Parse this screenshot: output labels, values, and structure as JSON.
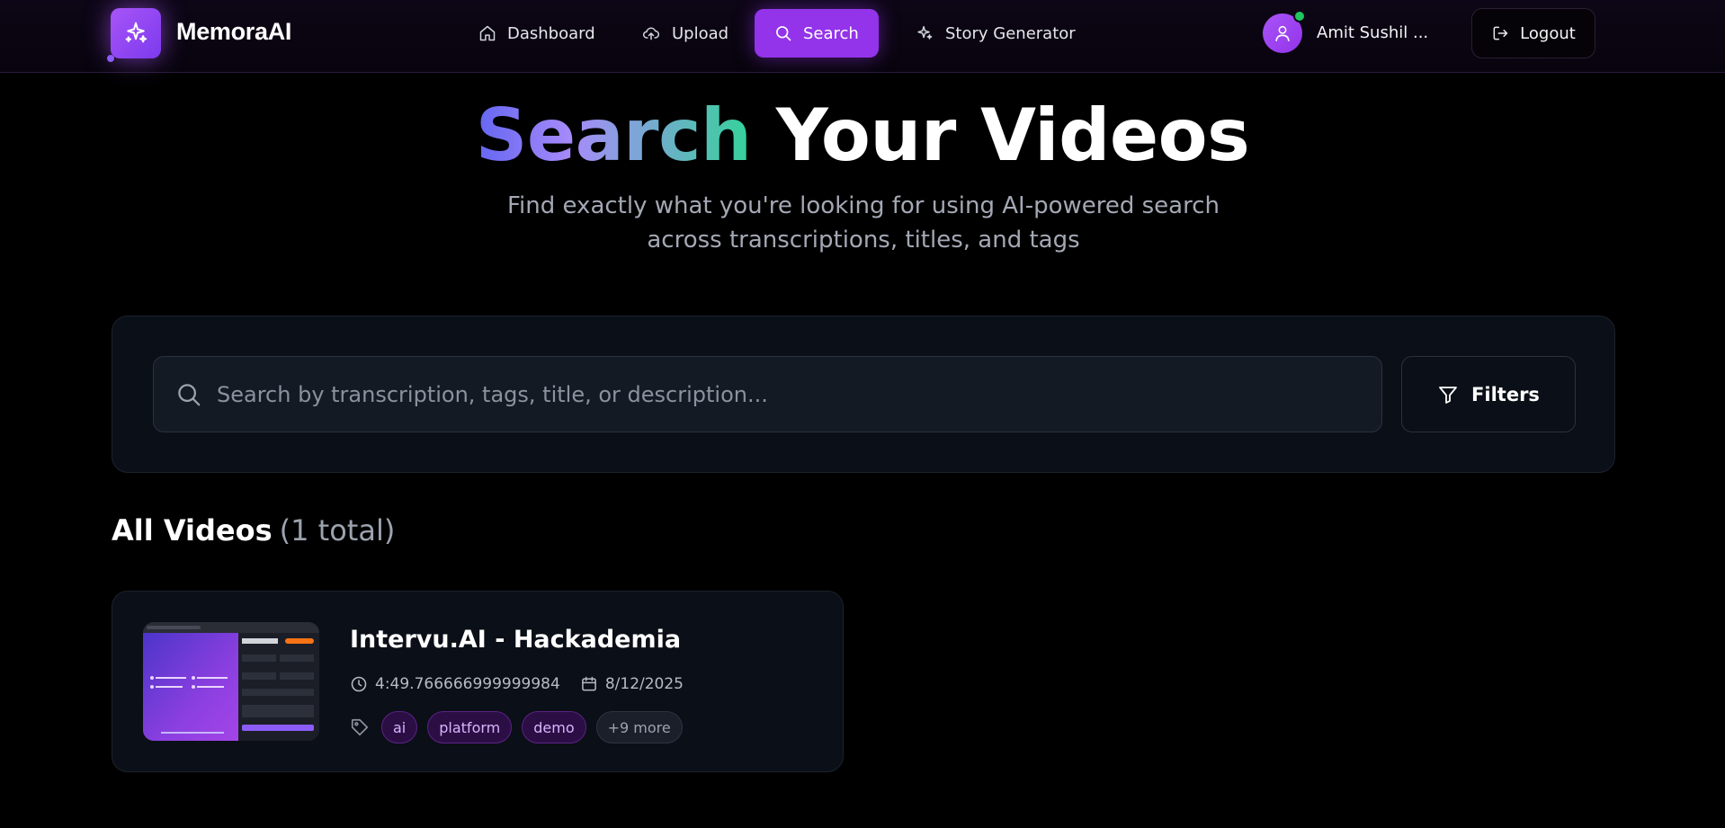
{
  "header": {
    "brand": "MemoraAI",
    "nav": [
      {
        "label": "Dashboard",
        "icon": "home-icon"
      },
      {
        "label": "Upload",
        "icon": "cloud-upload-icon"
      },
      {
        "label": "Search",
        "icon": "search-icon",
        "active": true
      },
      {
        "label": "Story Generator",
        "icon": "sparkles-icon"
      }
    ],
    "user_name": "Amit Sushil ...",
    "logout_label": "Logout"
  },
  "hero": {
    "title_highlight": "Search",
    "title_rest": "Your Videos",
    "subtitle": "Find exactly what you're looking for using AI-powered search across transcriptions, titles, and tags"
  },
  "search": {
    "placeholder": "Search by transcription, tags, title, or description...",
    "value": "",
    "filters_label": "Filters"
  },
  "results": {
    "heading": "All Videos",
    "count_label": "(1 total)",
    "videos": [
      {
        "title": "Intervu.AI - Hackademia",
        "duration": "4:49.766666999999984",
        "date": "8/12/2025",
        "tags": [
          "ai",
          "platform",
          "demo"
        ],
        "more_tags": "+9 more"
      }
    ]
  },
  "colors": {
    "accent": "#9333ea",
    "background": "#000000",
    "panel": "#0b0f17",
    "online": "#22c55e"
  }
}
